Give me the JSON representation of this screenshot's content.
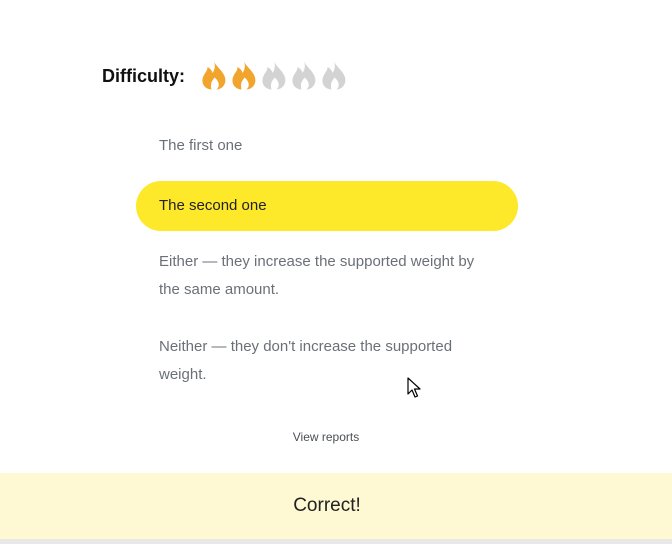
{
  "difficulty": {
    "label": "Difficulty:",
    "level": 2,
    "max": 5,
    "active_color": "#f2a52c",
    "inactive_color": "#d3d3d3",
    "icon": "flame-icon"
  },
  "options": [
    {
      "text": "The first one",
      "selected": false
    },
    {
      "text": "The second one",
      "selected": true
    },
    {
      "text": "Either — they increase the supported weight by the same amount.",
      "selected": false
    },
    {
      "text": "Neither — they don't increase the supported weight.",
      "selected": false
    }
  ],
  "selected_color": "#fde82a",
  "view_reports": "View reports",
  "status": {
    "text": "Correct!",
    "background": "#fef8d3"
  },
  "cursor_icon": "mouse-pointer-icon"
}
